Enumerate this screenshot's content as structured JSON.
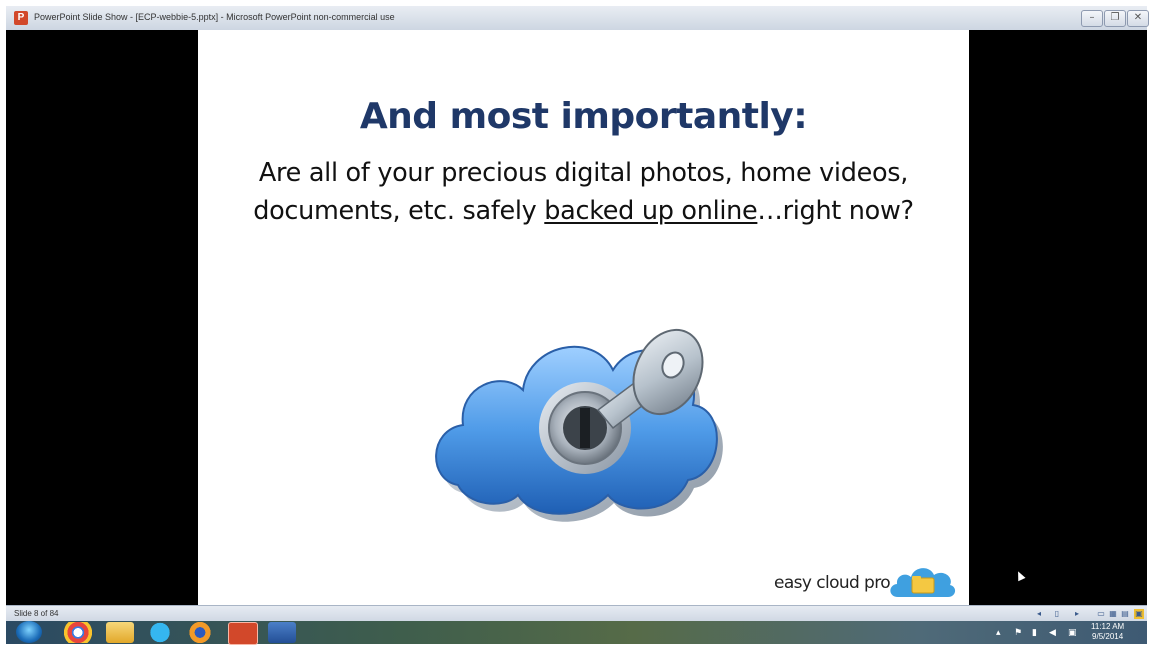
{
  "window": {
    "title": "PowerPoint Slide Show - [ECP-webbie-5.pptx] - Microsoft PowerPoint non-commercial use",
    "app_icon": "P",
    "controls": {
      "minimize": "–",
      "restore": "❐",
      "close": "✕"
    }
  },
  "slide": {
    "heading": "And most importantly:",
    "body_line1": "Are all of your precious digital photos, home videos,",
    "body_line2_pre": "documents, etc. safely ",
    "body_line2_link": "backed up online",
    "body_line2_post": "…right now?",
    "image": "cloud-with-key",
    "brand_text": "easy cloud pro",
    "heading_color": "#1f3868"
  },
  "statusbar": {
    "slide_counter": "Slide 8 of 84"
  },
  "taskbar": {
    "apps": [
      "windows-start",
      "chrome",
      "file-explorer",
      "skype",
      "firefox",
      "powerpoint",
      "snowflake-app"
    ],
    "time": "11:12 AM",
    "date": "9/5/2014"
  }
}
